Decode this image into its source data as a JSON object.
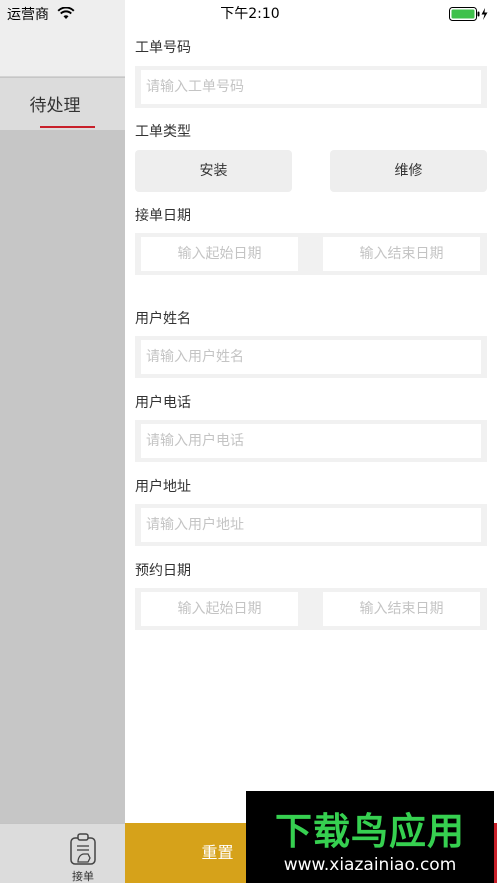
{
  "status_bar": {
    "carrier": "运营商",
    "time": "下午2:10"
  },
  "sidebar": {
    "tab_label": "待处理",
    "bottom_tab_label": "接单"
  },
  "form": {
    "order_no": {
      "label": "工单号码",
      "placeholder": "请输入工单号码"
    },
    "order_type": {
      "label": "工单类型",
      "options": [
        "安装",
        "维修"
      ]
    },
    "accept_date": {
      "label": "接单日期",
      "start_placeholder": "输入起始日期",
      "end_placeholder": "输入结束日期"
    },
    "user_name": {
      "label": "用户姓名",
      "placeholder": "请输入用户姓名"
    },
    "user_phone": {
      "label": "用户电话",
      "placeholder": "请输入用户电话"
    },
    "user_address": {
      "label": "用户地址",
      "placeholder": "请输入用户地址"
    },
    "appointment_date": {
      "label": "预约日期",
      "start_placeholder": "输入起始日期",
      "end_placeholder": "输入结束日期"
    }
  },
  "actions": {
    "reset_label": "重置"
  },
  "watermark": {
    "title": "下载鸟应用",
    "url": "www.xiazainiao.com"
  },
  "colors": {
    "accent_red": "#c8202a",
    "reset_yellow": "#d6a21a",
    "watermark_green": "#36d050"
  }
}
